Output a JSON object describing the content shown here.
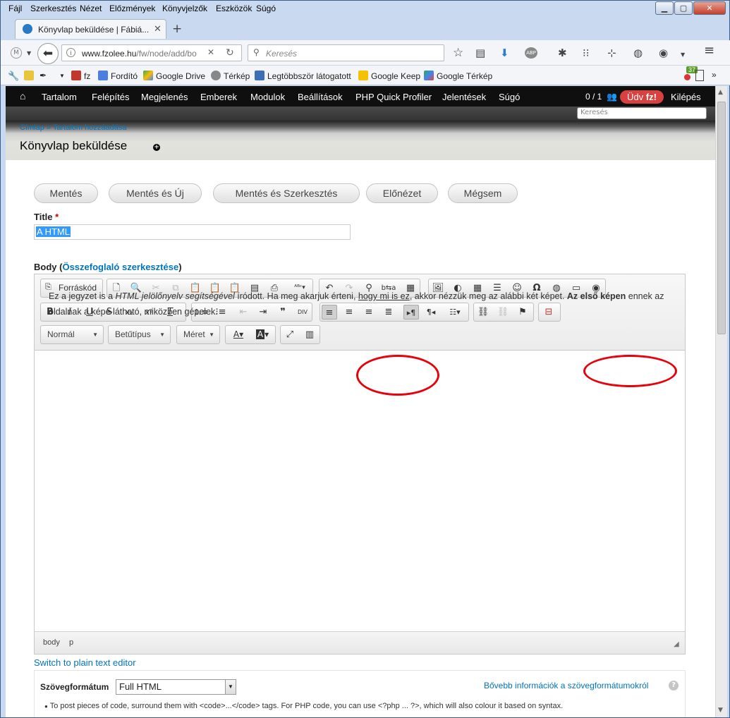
{
  "menubar": {
    "items": [
      "Fájl",
      "Szerkesztés",
      "Nézet",
      "Előzmények",
      "Könyvjelzők",
      "Eszközök",
      "Súgó"
    ]
  },
  "tab": {
    "title": "Könyvlap beküldése | Fábiá..."
  },
  "navbar": {
    "url_domain": "www.fzolee.hu",
    "url_path": "/fw/node/add/bo",
    "search_placeholder": "Keresés"
  },
  "bookmarks": {
    "items": [
      "fz",
      "Fordító",
      "Google Drive",
      "Térkép",
      "Legtöbbször látogatott",
      "Google Keep",
      "Google Térkép"
    ],
    "badge": "37"
  },
  "admin": {
    "menu": [
      "Tartalom",
      "Felépítés",
      "Megjelenés",
      "Emberek",
      "Modulok",
      "Beállítások",
      "PHP Quick Profiler",
      "Jelentések",
      "Súgó"
    ],
    "user_count": "0 / 1",
    "greeting": "Üdv",
    "username": "fz!",
    "logout": "Kilépés",
    "search_placeholder": "Keresés"
  },
  "breadcrumb": {
    "home": "Címlap",
    "sep": " » ",
    "current": "Tartalom hozzáadása"
  },
  "page": {
    "title": "Könyvlap beküldése"
  },
  "actions": {
    "save": "Mentés",
    "save_new": "Mentés és Új",
    "save_edit": "Mentés és Szerkesztés",
    "preview": "Előnézet",
    "cancel": "Mégsem"
  },
  "form": {
    "title_label": "Title",
    "required_mark": "*",
    "title_value": "A HTML",
    "body_label": "Body",
    "body_paren_open": " (",
    "summary_link": "Összefoglaló szerkesztése",
    "body_paren_close": ")"
  },
  "editor": {
    "source_button": "Forráskód",
    "format_combo": "Normál",
    "font_combo": "Betűtípus",
    "size_combo": "Méret",
    "content": {
      "t1": "Ez a jegyzet is a ",
      "t2_italic": "HTML jelölőnyelv segítségével",
      "t3": " íródott. Ha meg akarjuk érteni, ",
      "t4_underline": "hogy mi is ez",
      "t5": ", akkor nézzük meg az alábbi két képet. ",
      "t6_bold": "Az első képen",
      "t7": " ennek az oldalnak a képe látható, miközben gépelek."
    },
    "path_body": "body",
    "path_p": "p"
  },
  "plain_text_link": "Switch to plain text editor",
  "text_format": {
    "label": "Szövegformátum",
    "selected": "Full HTML",
    "help_link": "Bővebb információk a szövegformátumokról",
    "tip": "To post pieces of code, surround them with <code>...</code> tags. For PHP code, you can use <?php ... ?>, which will also colour it based on syntax."
  },
  "colors": {
    "admin_bg": "#0f0f0f",
    "link": "#0074bd",
    "greeting_badge": "#d94040",
    "annotation_red": "#e8000b",
    "selection": "#3399ff"
  }
}
